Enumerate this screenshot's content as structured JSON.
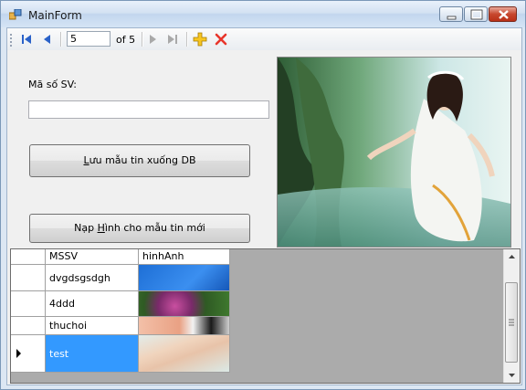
{
  "window": {
    "title": "MainForm"
  },
  "navigator": {
    "current_position": "5",
    "count_label": "of 5",
    "buttons": [
      "move-first",
      "move-previous",
      "move-next",
      "move-last",
      "add-new",
      "delete"
    ]
  },
  "form": {
    "masv_label": "Mã số SV:",
    "masv_value": "",
    "save_button": "Lưu mẫu tin xuống DB",
    "load_image_button": "Nạp Hình cho mẫu tin mới"
  },
  "grid": {
    "columns": [
      "MSSV",
      "hinhAnh"
    ],
    "rows": [
      {
        "mssv": "dvgdsgsdgh"
      },
      {
        "mssv": "4ddd"
      },
      {
        "mssv": "thuchoi"
      },
      {
        "mssv": "test"
      }
    ],
    "selected_row": 3
  },
  "colors": {
    "selection": "#3399ff",
    "title_bar": "#d3e1f2",
    "delete_icon": "#e8352b",
    "add_icon": "#f2b900"
  }
}
